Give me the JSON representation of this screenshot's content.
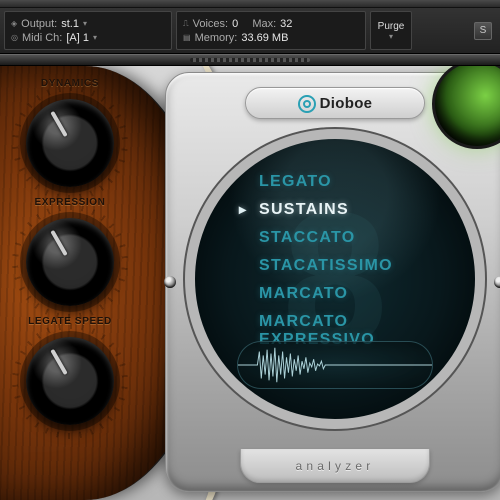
{
  "info": {
    "output_label": "Output:",
    "output_value": "st.1",
    "midi_label": "Midi Ch:",
    "midi_value": "[A] 1",
    "voices_label": "Voices:",
    "voices_value": "0",
    "max_label": "Max:",
    "max_value": "32",
    "memory_label": "Memory:",
    "memory_value": "33.69 MB",
    "purge_label": "Purge",
    "s_label": "S"
  },
  "knobs": {
    "dynamics": "DYNAMICS",
    "expression": "EXPRESSION",
    "legate_speed": "LEGATE SPEED"
  },
  "badge": {
    "brand": "Dioboe"
  },
  "watermark": "8",
  "articulations": [
    {
      "label": "LEGATO",
      "active": false
    },
    {
      "label": "SUSTAINS",
      "active": true
    },
    {
      "label": "STACCATO",
      "active": false
    },
    {
      "label": "STACATISSIMO",
      "active": false
    },
    {
      "label": "MARCATO",
      "active": false
    },
    {
      "label": "MARCATO EXPRESSIVO",
      "active": false
    }
  ],
  "analyzer_label": "analyzer"
}
